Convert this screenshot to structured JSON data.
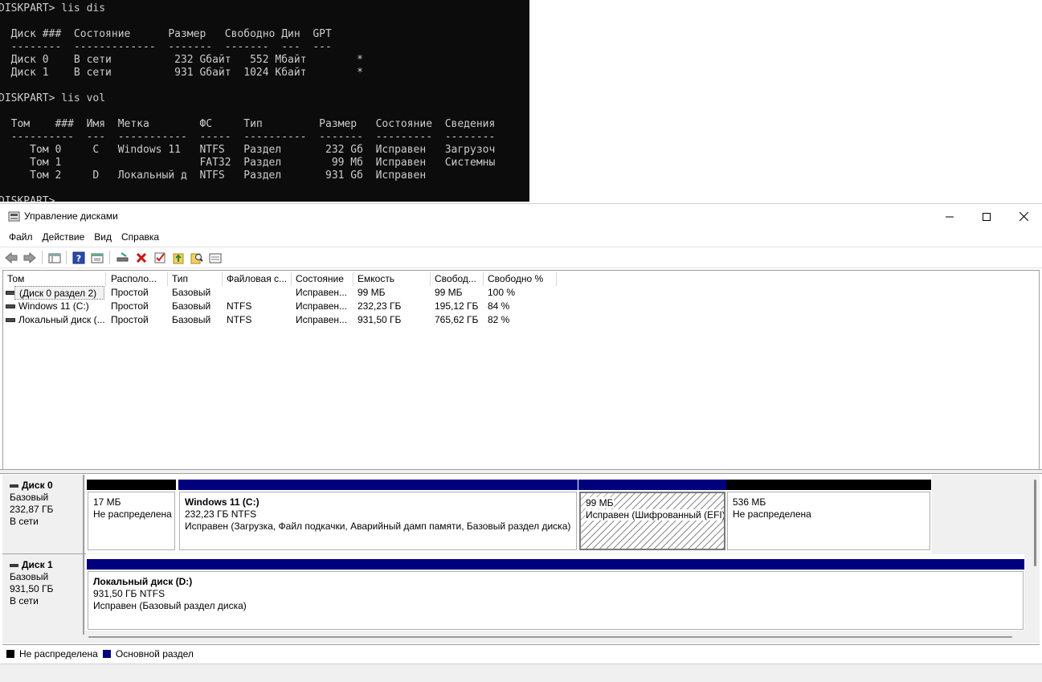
{
  "console": {
    "lines": [
      "DISKPART> lis dis",
      "",
      "  Диск ###  Состояние      Размер   Свободно Дин  GPT",
      "  --------  -------------  -------  -------  ---  ---",
      "  Диск 0    В сети          232 Gбайт   552 Mбайт        *",
      "  Диск 1    В сети          931 Gбайт  1024 Kбайт        *",
      "",
      "DISKPART> lis vol",
      "",
      "  Том    ###  Имя  Метка        ФС     Тип         Размер   Состояние  Сведения",
      "  ----------  ---  -----------  -----  ----------  -------  ---------  --------",
      "     Том 0     C   Windows 11   NTFS   Раздел       232 Gб  Исправен   Загрузоч",
      "     Том 1                      FAT32  Раздел        99 Mб  Исправен   Системны",
      "     Том 2     D   Локальный д  NTFS   Раздел       931 Gб  Исправен",
      "",
      "DISKPART>"
    ]
  },
  "window": {
    "title": "Управление дисками",
    "menu": [
      "Файл",
      "Действие",
      "Вид",
      "Справка"
    ]
  },
  "toolbar_icons": [
    "back-icon",
    "forward-icon",
    "console-tree-icon",
    "help-icon",
    "properties-icon",
    "connect-disk-icon",
    "delete-icon",
    "check-icon",
    "import-icon",
    "search-disk-icon",
    "disk-list-icon"
  ],
  "volume_list": {
    "columns": [
      "Том",
      "Располо...",
      "Тип",
      "Файловая с...",
      "Состояние",
      "Емкость",
      "Свобод...",
      "Свободно %"
    ],
    "rows": [
      {
        "vol": "(Диск 0 раздел 2)",
        "layout": "Простой",
        "type": "Базовый",
        "fs": "",
        "status": "Исправен...",
        "capacity": "99 МБ",
        "free": "99 МБ",
        "free_pct": "100 %"
      },
      {
        "vol": "Windows 11 (C:)",
        "layout": "Простой",
        "type": "Базовый",
        "fs": "NTFS",
        "status": "Исправен...",
        "capacity": "232,23 ГБ",
        "free": "195,12 ГБ",
        "free_pct": "84 %"
      },
      {
        "vol": "Локальный диск (...",
        "layout": "Простой",
        "type": "Базовый",
        "fs": "NTFS",
        "status": "Исправен...",
        "capacity": "931,50 ГБ",
        "free": "765,62 ГБ",
        "free_pct": "82 %"
      }
    ]
  },
  "disks": [
    {
      "name": "Диск 0",
      "kind": "Базовый",
      "size": "232,87 ГБ",
      "state": "В сети",
      "partitions": [
        {
          "title": "",
          "size": "17 МБ",
          "status": "Не распределена",
          "bar_color": "#000000",
          "hatched": false
        },
        {
          "title": "Windows 11  (C:)",
          "size": "232,23 ГБ NTFS",
          "status": "Исправен (Загрузка, Файл подкачки, Аварийный дамп памяти, Базовый раздел диска)",
          "bar_color": "#00007f",
          "hatched": false
        },
        {
          "title": "",
          "size": "99 МБ",
          "status": "Исправен (Шифрованный (EFI)",
          "bar_color": "#00007f",
          "hatched": true
        },
        {
          "title": "",
          "size": "536 МБ",
          "status": "Не распределена",
          "bar_color": "#000000",
          "hatched": false
        }
      ]
    },
    {
      "name": "Диск 1",
      "kind": "Базовый",
      "size": "931,50 ГБ",
      "state": "В сети",
      "partitions": [
        {
          "title": "Локальный диск  (D:)",
          "size": "931,50 ГБ NTFS",
          "status": "Исправен (Базовый раздел диска)",
          "bar_color": "#00007f",
          "hatched": false
        }
      ]
    }
  ],
  "legend": [
    {
      "label": "Не распределена",
      "color": "#000000"
    },
    {
      "label": "Основной раздел",
      "color": "#00007f"
    }
  ]
}
